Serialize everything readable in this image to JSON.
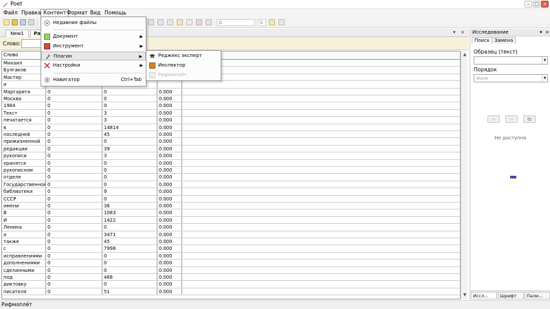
{
  "window": {
    "title": "Poet"
  },
  "menubar": [
    "Файл",
    "Правка",
    "Контент",
    "Формат",
    "Вид",
    "Помощь"
  ],
  "toolbar": {
    "font_combo": "D",
    "size_combo": "S"
  },
  "doc_tabs": [
    "New1",
    "Ра"
  ],
  "word_bar": {
    "label": "Слово:",
    "value": ""
  },
  "table": {
    "header": "Слово",
    "rows": [
      [
        "Михаил",
        "",
        "",
        ""
      ],
      [
        "Булгаков",
        "",
        "",
        ""
      ],
      [
        "Мастер",
        "",
        "",
        ""
      ],
      [
        "и",
        "",
        "",
        ""
      ],
      [
        "Маргарита",
        "0",
        "0",
        "0.000"
      ],
      [
        "Москва",
        "0",
        "0",
        "0.000"
      ],
      [
        "1984",
        "0",
        "0",
        "0.000"
      ],
      [
        "Текст",
        "0",
        "3",
        "0.000"
      ],
      [
        "печатается",
        "0",
        "3",
        "0.000"
      ],
      [
        "в",
        "0",
        "14814",
        "0.000"
      ],
      [
        "последней",
        "0",
        "45",
        "0.000"
      ],
      [
        "прижизненной",
        "0",
        "0",
        "0.000"
      ],
      [
        "редакции",
        "0",
        "39",
        "0.000"
      ],
      [
        "рукописи",
        "0",
        "3",
        "0.000"
      ],
      [
        "хранятся",
        "0",
        "0",
        "0.000"
      ],
      [
        "рукописном",
        "0",
        "0",
        "0.000"
      ],
      [
        "отделе",
        "0",
        "0",
        "0.000"
      ],
      [
        "Государственной",
        "0",
        "0",
        "0.000"
      ],
      [
        "библиотеки",
        "0",
        "9",
        "0.000"
      ],
      [
        "СССР",
        "0",
        "0",
        "0.000"
      ],
      [
        "имени",
        "0",
        "36",
        "0.000"
      ],
      [
        "В",
        "0",
        "1083",
        "0.000"
      ],
      [
        "И",
        "0",
        "1422",
        "0.000"
      ],
      [
        "Ленина",
        "0",
        "0",
        "0.000"
      ],
      [
        "а",
        "0",
        "3471",
        "0.000"
      ],
      [
        "также",
        "0",
        "45",
        "0.000"
      ],
      [
        "с",
        "0",
        "7998",
        "0.000"
      ],
      [
        "исправлениями",
        "0",
        "0",
        "0.000"
      ],
      [
        "дополнениями",
        "0",
        "0",
        "0.000"
      ],
      [
        "сделанными",
        "0",
        "0",
        "0.000"
      ],
      [
        "под",
        "0",
        "468",
        "0.000"
      ],
      [
        "диктовку",
        "0",
        "0",
        "0.000"
      ],
      [
        "писателя",
        "0",
        "51",
        "0.000"
      ]
    ]
  },
  "content_menu": {
    "items": [
      {
        "label": "Недавние файлы",
        "icon": "chevron-circle-icon",
        "submenu": false
      },
      {
        "label": "Документ",
        "icon": "document-icon",
        "submenu": true
      },
      {
        "label": "Инструмент",
        "icon": "toolbox-icon",
        "submenu": true
      },
      {
        "label": "Плагин",
        "icon": "plugin-icon",
        "submenu": true
      },
      {
        "label": "Настройки",
        "icon": "settings-icon",
        "submenu": true
      },
      {
        "label": "Навигатор",
        "icon": "navigator-icon",
        "shortcut": "Ctrl+Tab"
      }
    ]
  },
  "plugin_submenu": {
    "items": [
      {
        "label": "Реджекс эксперт",
        "icon": "graduation-cap-icon",
        "disabled": false
      },
      {
        "label": "Инспектор",
        "icon": "inspector-icon",
        "disabled": false
      },
      {
        "label": "Рифмоплёт",
        "icon": "rhyme-icon",
        "disabled": true
      }
    ]
  },
  "research_panel": {
    "title": "Исследование",
    "tabs": [
      "Поиск",
      "Замена"
    ],
    "sample_label": "Образец (текст)",
    "order_label": "Порядок",
    "order_value": "None",
    "not_available": "Не доступно",
    "bottom_tabs": [
      "Иссл...",
      "Шрифт",
      "Пали..."
    ]
  },
  "statusbar": {
    "text": "Рифмоплёт"
  },
  "colors": {
    "word_bar_bg": "#f7f1dc",
    "close_button": "#e15b4f"
  }
}
